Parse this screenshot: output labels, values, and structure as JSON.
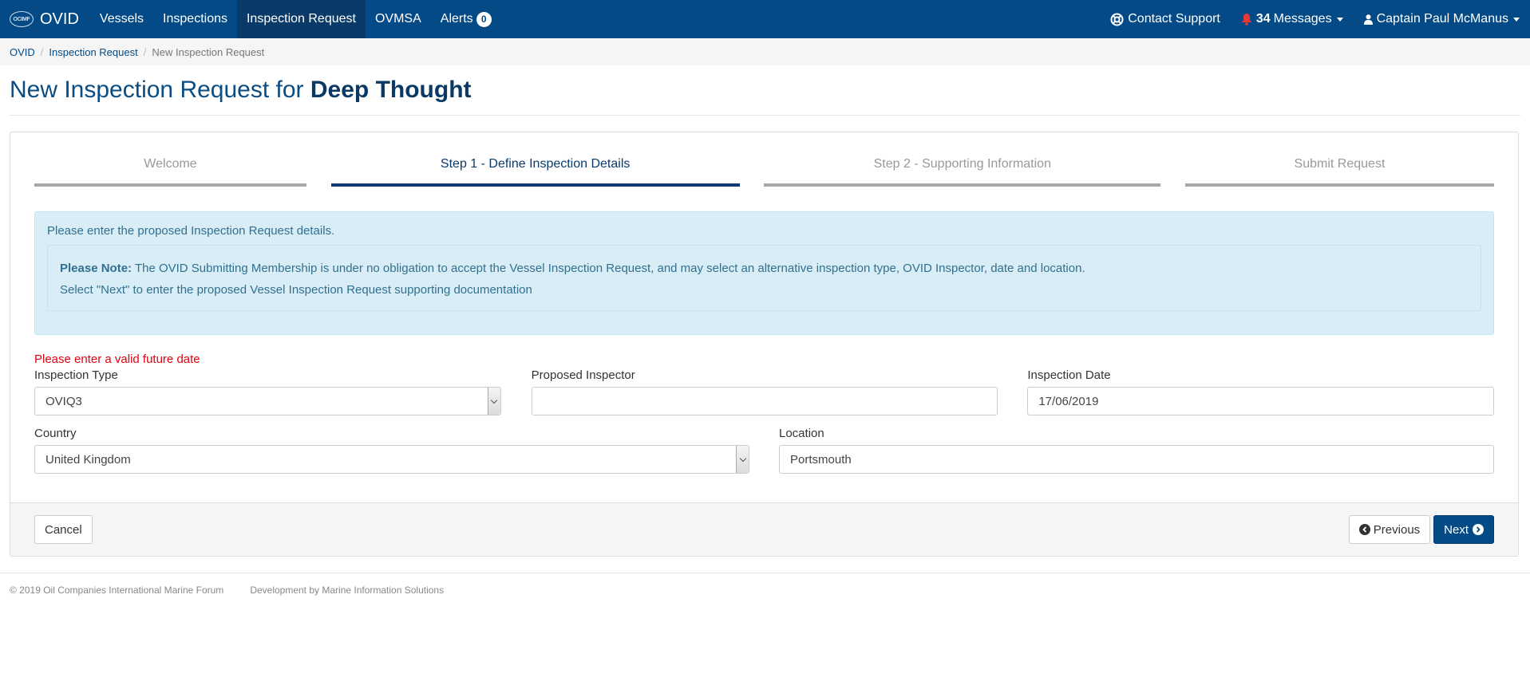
{
  "navbar": {
    "brand_logo": "OCIMF",
    "brand": "OVID",
    "items": [
      "Vessels",
      "Inspections",
      "Inspection Request",
      "OVMSA",
      "Alerts"
    ],
    "alerts_count": "0",
    "contact_support": "Contact Support",
    "messages_count": "34",
    "messages_label": "Messages",
    "user": "Captain Paul McManus",
    "colors": {
      "bar": "#044a86",
      "active": "#0a3b68",
      "bell": "#e53935"
    }
  },
  "breadcrumb": [
    "OVID",
    "Inspection Request",
    "New Inspection Request"
  ],
  "page": {
    "title_prefix": "New Inspection Request for",
    "vessel_name": "Deep Thought"
  },
  "wizard": {
    "steps": [
      "Welcome",
      "Step 1 - Define Inspection Details",
      "Step 2 - Supporting Information",
      "Submit Request"
    ],
    "active_step": 1
  },
  "info": {
    "intro": "Please enter the proposed Inspection Request details.",
    "note_label": "Please Note:",
    "note_text": " The OVID Submitting Membership is under no obligation to accept the Vessel Inspection Request, and may select an alternative inspection type, OVID Inspector, date and location.",
    "next_hint": "Select \"Next\" to enter the proposed Vessel Inspection Request supporting documentation"
  },
  "form": {
    "error": "Please enter a valid future date",
    "inspection_type": {
      "label": "Inspection Type",
      "value": "OVIQ3"
    },
    "proposed_inspector": {
      "label": "Proposed Inspector",
      "value": ""
    },
    "inspection_date": {
      "label": "Inspection Date",
      "value": "17/06/2019"
    },
    "country": {
      "label": "Country",
      "value": "United Kingdom"
    },
    "location": {
      "label": "Location",
      "value": "Portsmouth"
    }
  },
  "buttons": {
    "cancel": "Cancel",
    "previous": "Previous",
    "next": "Next"
  },
  "footer": {
    "copyright": "© 2019 Oil Companies International Marine Forum",
    "credit": "Development by Marine Information Solutions"
  }
}
